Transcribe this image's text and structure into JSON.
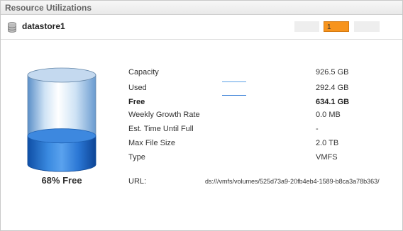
{
  "panel": {
    "title": "Resource Utilizations"
  },
  "datastore": {
    "name": "datastore1",
    "icon": "database-icon"
  },
  "pager": {
    "current": "1",
    "accent": "#f7941d"
  },
  "usage": {
    "free_fraction": 0.68,
    "free_label": "68% Free",
    "fill_color": "#2a76d4"
  },
  "stats": {
    "capacity": {
      "label": "Capacity",
      "value": "926.5 GB"
    },
    "used": {
      "label": "Used",
      "value": "292.4 GB",
      "color": "#5aa0e6"
    },
    "free": {
      "label": "Free",
      "value": "634.1 GB",
      "color": "#2a76d4"
    },
    "growth": {
      "label": "Weekly Growth Rate",
      "value": "0.0 MB"
    },
    "time_full": {
      "label": "Est. Time Until Full",
      "value": "-"
    },
    "max_file": {
      "label": "Max File Size",
      "value": "2.0 TB"
    },
    "type": {
      "label": "Type",
      "value": "VMFS"
    },
    "url": {
      "label": "URL:",
      "value": "ds:///vmfs/volumes/525d73a9-20fb4eb4-1589-b8ca3a78b363/"
    }
  }
}
